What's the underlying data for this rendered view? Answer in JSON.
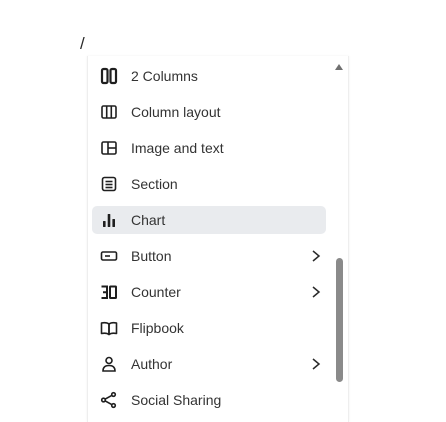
{
  "breadcrumb": {
    "slash": "/"
  },
  "menu": {
    "items": [
      {
        "label": "2 Columns",
        "icon": "two-columns-icon",
        "submenu": false,
        "active": false
      },
      {
        "label": "Column layout",
        "icon": "column-layout-icon",
        "submenu": false,
        "active": false
      },
      {
        "label": "Image and text",
        "icon": "image-text-icon",
        "submenu": false,
        "active": false
      },
      {
        "label": "Section",
        "icon": "section-icon",
        "submenu": false,
        "active": false
      },
      {
        "label": "Chart",
        "icon": "chart-icon",
        "submenu": false,
        "active": true
      },
      {
        "label": "Button",
        "icon": "button-icon",
        "submenu": true,
        "active": false
      },
      {
        "label": "Counter",
        "icon": "counter-icon",
        "submenu": true,
        "active": false
      },
      {
        "label": "Flipbook",
        "icon": "book-open-icon",
        "submenu": false,
        "active": false
      },
      {
        "label": "Author",
        "icon": "user-icon",
        "submenu": true,
        "active": false
      },
      {
        "label": "Social Sharing",
        "icon": "share-icon",
        "submenu": false,
        "active": false
      }
    ]
  },
  "colors": {
    "active_bg": "#e9ebee",
    "scroll_thumb": "#8a8a8a",
    "icon": "#1f1f1f"
  }
}
